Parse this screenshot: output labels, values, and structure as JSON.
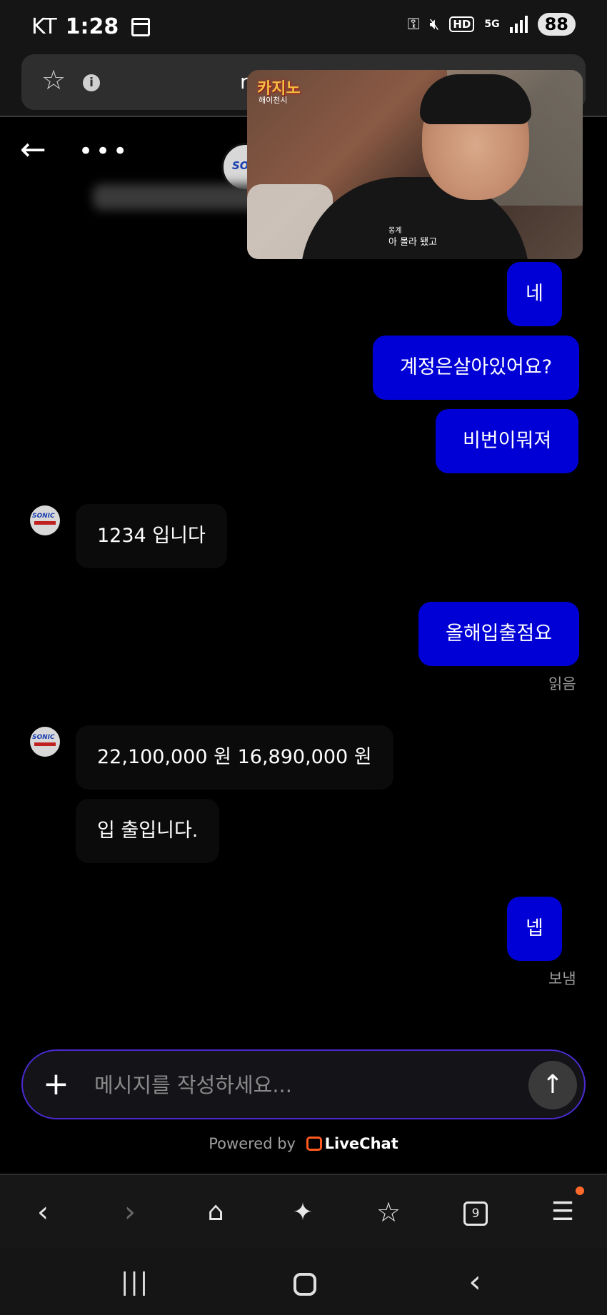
{
  "status_bar": {
    "carrier": "KT",
    "time": "1:28",
    "icons": [
      "calendar-icon",
      "key-icon",
      "mute-icon",
      "hd-icon",
      "5g-icon",
      "signal-icon"
    ],
    "hd_label": "HD",
    "network_label": "5G",
    "battery": "88"
  },
  "browser": {
    "url_partial": "r",
    "toolbar": {
      "tab_count": "9"
    },
    "notification_dot_color": "#ff6a2a"
  },
  "pip_video": {
    "logo_text": "카지노",
    "logo_sub": "해이천시",
    "subtitle_small": "몽계",
    "subtitle": "아 몰라 됐고"
  },
  "chat": {
    "messages": [
      {
        "from": "user",
        "text": "네"
      },
      {
        "from": "user",
        "text": "계정은살아있어요?"
      },
      {
        "from": "user",
        "text": "비번이뭐져"
      },
      {
        "from": "agent",
        "text": "1234 입니다"
      },
      {
        "from": "user",
        "text": "올해입출점요",
        "status": "읽음"
      },
      {
        "from": "agent",
        "text": "22,100,000 원 16,890,000 원"
      },
      {
        "from": "agent",
        "text": "입 출입니다."
      },
      {
        "from": "user",
        "text": "넵",
        "status": "보냄"
      }
    ],
    "agent_avatar_label": "SONIC"
  },
  "composer": {
    "placeholder": "메시지를 작성하세요..."
  },
  "footer": {
    "powered_by": "Powered by",
    "brand": "LiveChat"
  },
  "colors": {
    "user_bubble": "#0000d6",
    "composer_border": "#4a2ad0",
    "livechat_orange": "#ff5a1f"
  }
}
